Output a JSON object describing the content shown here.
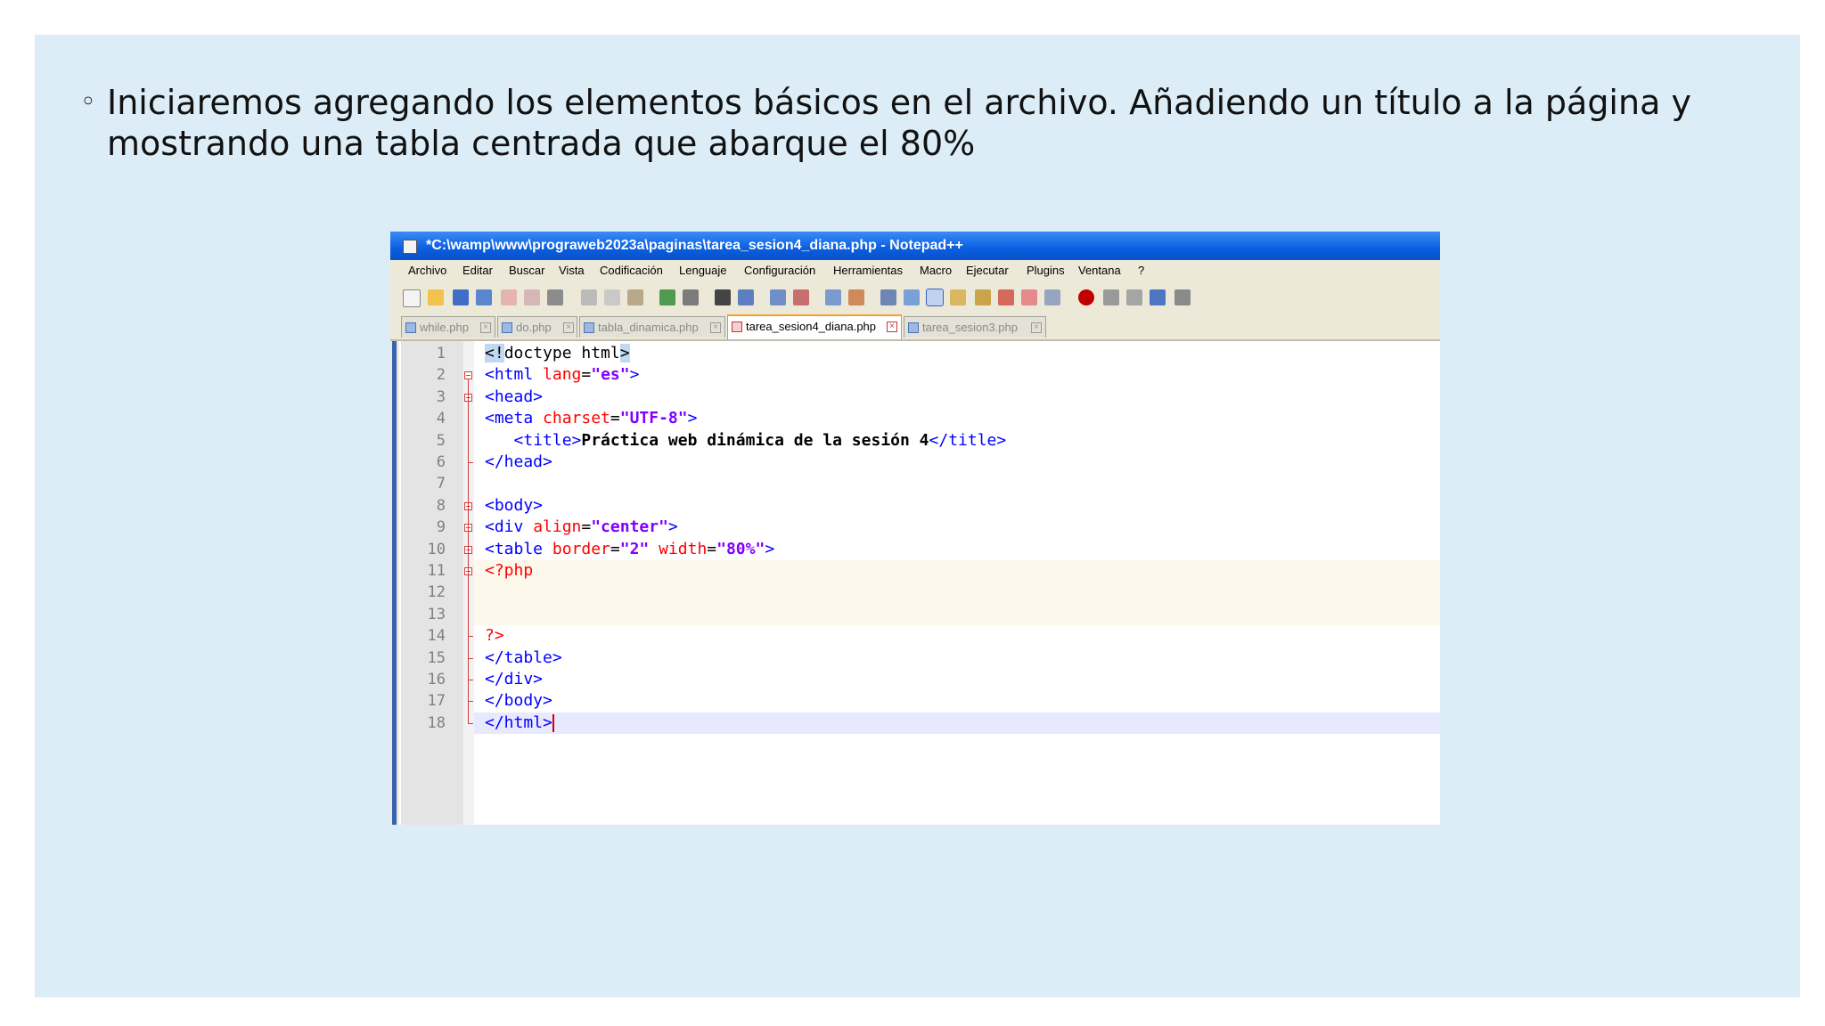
{
  "slide": {
    "bullet_text": "Iniciaremos agregando los elementos básicos en el archivo. Añadiendo un título a la página y mostrando una tabla centrada que abarque el 80%"
  },
  "window": {
    "title": "*C:\\wamp\\www\\prograweb2023a\\paginas\\tarea_sesion4_diana.php - Notepad++"
  },
  "menu": [
    "Archivo",
    "Editar",
    "Buscar",
    "Vista",
    "Codificación",
    "Lenguaje",
    "Configuración",
    "Herramientas",
    "Macro",
    "Ejecutar",
    "Plugins",
    "Ventana",
    "?"
  ],
  "tabs": [
    {
      "label": "while.php",
      "active": false
    },
    {
      "label": "do.php",
      "active": false
    },
    {
      "label": "tabla_dinamica.php",
      "active": false
    },
    {
      "label": "tarea_sesion4_diana.php",
      "active": true
    },
    {
      "label": "tarea_sesion3.php",
      "active": false
    }
  ],
  "editor": {
    "line_numbers": [
      "1",
      "2",
      "3",
      "4",
      "5",
      "6",
      "7",
      "8",
      "9",
      "10",
      "11",
      "12",
      "13",
      "14",
      "15",
      "16",
      "17",
      "18"
    ],
    "lines": [
      [
        [
          "hl",
          "<!"
        ],
        [
          "plain",
          "doctype html"
        ],
        [
          "hl",
          ">"
        ]
      ],
      [
        [
          "t",
          "<html "
        ],
        [
          "a",
          "lang"
        ],
        [
          "plain",
          "="
        ],
        [
          "s",
          "\"es\""
        ],
        [
          "t",
          ">"
        ]
      ],
      [
        [
          "t",
          "<head>"
        ]
      ],
      [
        [
          "t",
          "<meta "
        ],
        [
          "a",
          "charset"
        ],
        [
          "plain",
          "="
        ],
        [
          "s",
          "\"UTF-8\""
        ],
        [
          "t",
          ">"
        ]
      ],
      [
        [
          "plain",
          "   "
        ],
        [
          "t",
          "<title>"
        ],
        [
          "b",
          "Práctica web dinámica de la sesión 4"
        ],
        [
          "t",
          "</title>"
        ]
      ],
      [
        [
          "t",
          "</head>"
        ]
      ],
      [],
      [
        [
          "t",
          "<body>"
        ]
      ],
      [
        [
          "t",
          "<div "
        ],
        [
          "a",
          "align"
        ],
        [
          "plain",
          "="
        ],
        [
          "s",
          "\"center\""
        ],
        [
          "t",
          ">"
        ]
      ],
      [
        [
          "t",
          "<table "
        ],
        [
          "a",
          "border"
        ],
        [
          "plain",
          "="
        ],
        [
          "s",
          "\"2\""
        ],
        [
          "plain",
          " "
        ],
        [
          "a",
          "width"
        ],
        [
          "plain",
          "="
        ],
        [
          "s",
          "\"80%\""
        ],
        [
          "t",
          ">"
        ]
      ],
      [
        [
          "php",
          "<?php"
        ]
      ],
      [],
      [],
      [
        [
          "php",
          "?>"
        ]
      ],
      [
        [
          "t",
          "</table>"
        ]
      ],
      [
        [
          "t",
          "</div>"
        ]
      ],
      [
        [
          "t",
          "</body>"
        ]
      ],
      [
        [
          "t",
          "</html>"
        ]
      ]
    ]
  }
}
